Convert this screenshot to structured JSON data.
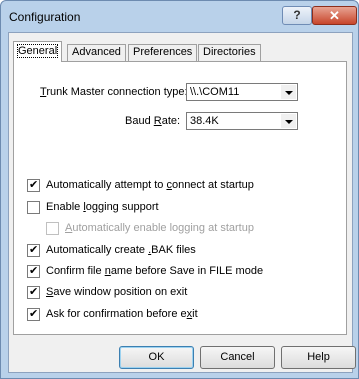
{
  "window": {
    "title": "Configuration",
    "help_glyph": "?",
    "close_glyph": "✕"
  },
  "tabs": [
    {
      "label": "General",
      "active": true
    },
    {
      "label": "Advanced"
    },
    {
      "label": "Preferences"
    },
    {
      "label": "Directories"
    }
  ],
  "general": {
    "connection_type": {
      "label_pre": "T",
      "label_rest": "runk Master connection type:",
      "value": "\\\\.\\COM11"
    },
    "baud_rate": {
      "label_pre": "Baud ",
      "label_acc": "R",
      "label_post": "ate:",
      "value": "38.4K"
    }
  },
  "options": [
    {
      "pre": "Automatically attempt to ",
      "acc": "c",
      "post": "onnect at startup",
      "checked": true,
      "disabled": false
    },
    {
      "pre": "Enable ",
      "acc": "l",
      "post": "ogging support",
      "checked": false,
      "disabled": false
    },
    {
      "pre": "",
      "acc": "A",
      "post": "utomatically enable logging at startup",
      "checked": false,
      "disabled": true
    },
    {
      "pre": "Automatically create ",
      "acc": ".",
      "post": "BAK files",
      "checked": true,
      "disabled": false
    },
    {
      "pre": "Confirm file ",
      "acc": "n",
      "post": "ame before Save in FILE mode",
      "checked": true,
      "disabled": false
    },
    {
      "pre": "",
      "acc": "S",
      "post": "ave window position on exit",
      "checked": true,
      "disabled": false
    },
    {
      "pre": "Ask for confirmation before e",
      "acc": "x",
      "post": "it",
      "checked": true,
      "disabled": false
    }
  ],
  "buttons": {
    "ok": "OK",
    "cancel": "Cancel",
    "help": "Help"
  }
}
